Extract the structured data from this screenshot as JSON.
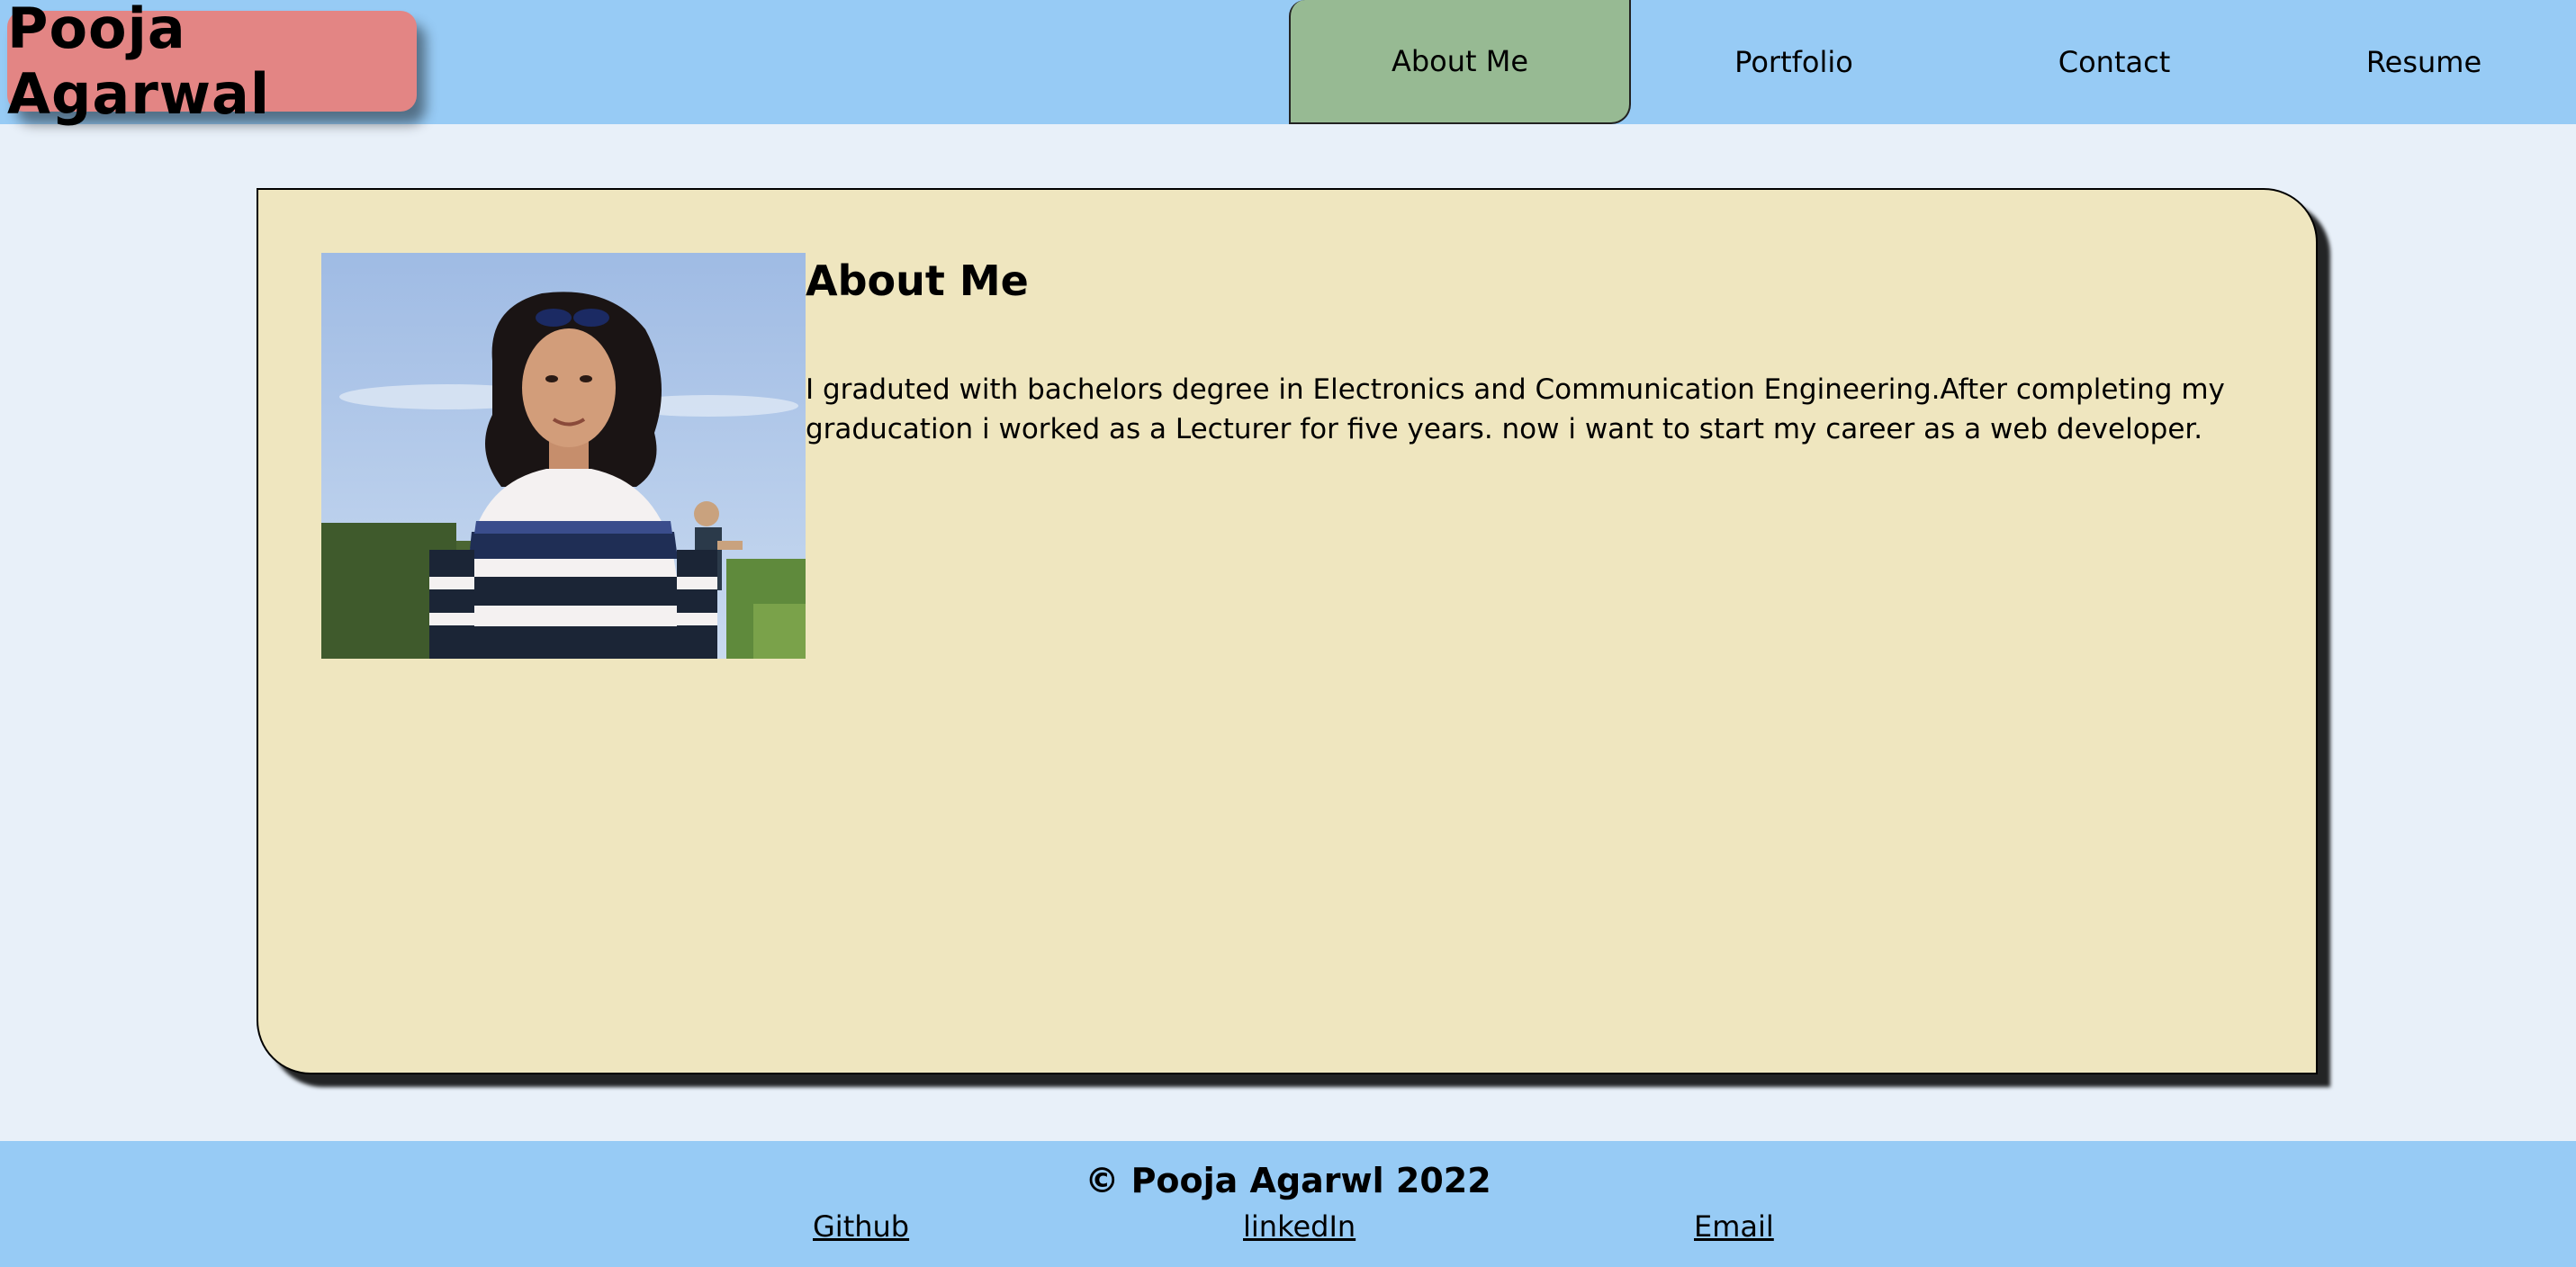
{
  "header": {
    "brand": "Pooja Agarwal",
    "nav": [
      {
        "label": "About Me",
        "active": true
      },
      {
        "label": "Portfolio",
        "active": false
      },
      {
        "label": "Contact",
        "active": false
      },
      {
        "label": "Resume",
        "active": false
      }
    ]
  },
  "main": {
    "title": "About Me",
    "paragraph": "I graduted with bachelors degree in Electronics and Communication Engineering.After completing my graducation i worked as a Lecturer for five years. now i want to start my career as a web developer."
  },
  "footer": {
    "copyright": "© Pooja Agarwl 2022",
    "links": [
      "Github",
      "linkedIn",
      "Email"
    ]
  },
  "colors": {
    "header_bg": "#97cbf5",
    "brand_bg": "#e38584",
    "active_tab": "#97ba93",
    "card_bg": "#efe6bf",
    "page_bg": "#e8f0f9"
  }
}
